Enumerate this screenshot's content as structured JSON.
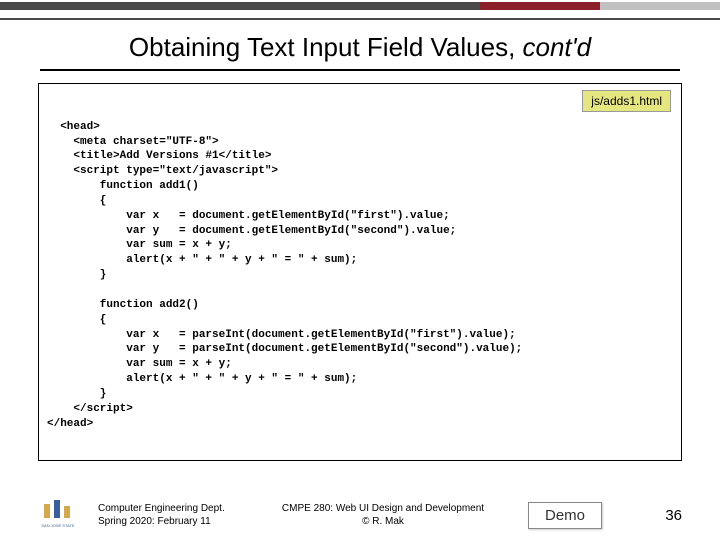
{
  "header": {
    "title_plain": "Obtaining Text Input Field Values, ",
    "title_italic": "cont'd"
  },
  "file_label": "js/adds1.html",
  "code": "<head>\n    <meta charset=\"UTF-8\">\n    <title>Add Versions #1</title>\n    <script type=\"text/javascript\">\n        function add1()\n        {\n            var x   = document.getElementById(\"first\").value;\n            var y   = document.getElementById(\"second\").value;\n            var sum = x + y;\n            alert(x + \" + \" + y + \" = \" + sum);\n        }\n\n        function add2()\n        {\n            var x   = parseInt(document.getElementById(\"first\").value);\n            var y   = parseInt(document.getElementById(\"second\").value);\n            var sum = x + y;\n            alert(x + \" + \" + y + \" = \" + sum);\n        }\n    </script>\n</head>",
  "footer": {
    "dept_line1": "Computer Engineering Dept.",
    "dept_line2": "Spring 2020: February 11",
    "course_line1": "CMPE 280: Web UI Design and Development",
    "course_line2": "© R. Mak",
    "demo": "Demo",
    "page": "36"
  }
}
